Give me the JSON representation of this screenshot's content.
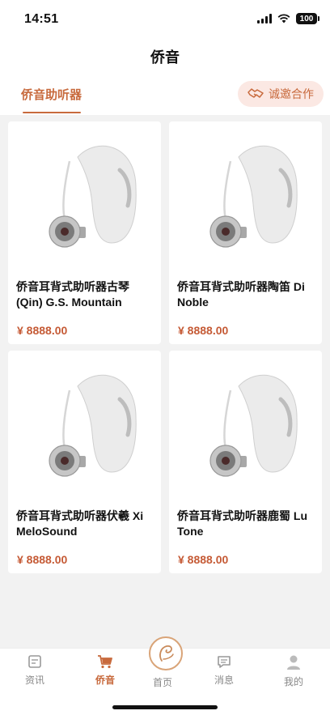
{
  "status": {
    "time": "14:51",
    "battery": "100"
  },
  "header": {
    "title": "侨音"
  },
  "tabs": {
    "active_label": "侨音助听器",
    "coop_label": "诚邀合作"
  },
  "products": [
    {
      "title": "侨音耳背式助听器古琴(Qin) G.S. Mountain",
      "price": "¥ 8888.00"
    },
    {
      "title": "侨音耳背式助听器陶笛 Di Noble",
      "price": "¥ 8888.00"
    },
    {
      "title": "侨音耳背式助听器伏羲 Xi MeloSound",
      "price": "¥ 8888.00"
    },
    {
      "title": "侨音耳背式助听器鹿蜀 Lu Tone",
      "price": "¥ 8888.00"
    }
  ],
  "tabbar": {
    "items": [
      {
        "label": "资讯",
        "icon": "news-icon"
      },
      {
        "label": "侨音",
        "icon": "cart-icon",
        "active": true
      },
      {
        "label": "首页",
        "icon": "home-logo-icon"
      },
      {
        "label": "消息",
        "icon": "message-icon"
      },
      {
        "label": "我的",
        "icon": "user-icon"
      }
    ]
  },
  "colors": {
    "accent": "#c86a3d",
    "price": "#c55a35",
    "coop_bg": "#fbe8e3",
    "background": "#f2f2f2"
  }
}
